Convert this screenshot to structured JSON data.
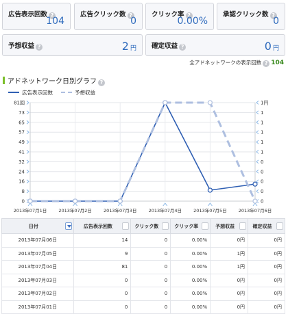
{
  "stats": {
    "impressions": {
      "label": "広告表示回数",
      "value": "104"
    },
    "ad_clicks": {
      "label": "広告クリック数",
      "value": "0"
    },
    "ctr": {
      "label": "クリック率",
      "value": "0.00%"
    },
    "approved_clicks": {
      "label": "承認クリック数",
      "value": "0"
    },
    "estimated_revenue": {
      "label": "予想収益",
      "value": "2",
      "unit": "円"
    },
    "confirmed_revenue": {
      "label": "確定収益",
      "value": "0",
      "unit": "円"
    }
  },
  "network_total": {
    "label": "全アドネットワークの表示回数",
    "value": "104"
  },
  "graph": {
    "title": "アドネットワーク日別グラフ"
  },
  "help_icon_glyph": "?",
  "chart_data": {
    "type": "line",
    "categories": [
      "2013年07月1日",
      "2013年07月2日",
      "2013年07月3日",
      "2013年07月4日",
      "2013年07月5日",
      "2013年07月6日"
    ],
    "series": [
      {
        "name": "広告表示回数",
        "axis": "left",
        "style": "solid",
        "color": "#2f5fb3",
        "values": [
          0,
          0,
          0,
          81,
          9,
          14
        ]
      },
      {
        "name": "予想収益",
        "axis": "right",
        "style": "dashed",
        "color": "#aebfe0",
        "values": [
          0,
          0,
          0,
          1,
          1,
          0
        ]
      }
    ],
    "y_left": {
      "ticks": [
        "81回",
        "73",
        "65",
        "57",
        "49",
        "41",
        "32",
        "24",
        "16",
        "8",
        "0"
      ],
      "range": [
        0,
        81
      ]
    },
    "y_right": {
      "ticks": [
        "1円",
        "1",
        "1",
        "1",
        "1",
        "1",
        "0",
        "0",
        "0",
        "0",
        "0"
      ],
      "range": [
        0,
        1
      ]
    },
    "grid": true
  },
  "table": {
    "headers": [
      "日付",
      "広告表示回数",
      "クリック数",
      "クリック率",
      "予想収益",
      "確定収益"
    ],
    "rows": [
      [
        "2013年07月06日",
        "14",
        "0",
        "0.00%",
        "0円",
        "0円"
      ],
      [
        "2013年07月05日",
        "9",
        "0",
        "0.00%",
        "1円",
        "0円"
      ],
      [
        "2013年07月04日",
        "81",
        "0",
        "0.00%",
        "1円",
        "0円"
      ],
      [
        "2013年07月03日",
        "0",
        "0",
        "0.00%",
        "0円",
        "0円"
      ],
      [
        "2013年07月02日",
        "0",
        "0",
        "0.00%",
        "0円",
        "0円"
      ],
      [
        "2013年07月01日",
        "0",
        "0",
        "0.00%",
        "0円",
        "0円"
      ]
    ]
  }
}
